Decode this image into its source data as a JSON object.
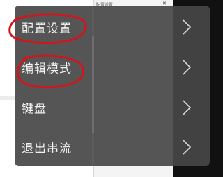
{
  "background": {
    "window_title": "配置设置"
  },
  "menu": {
    "items": [
      {
        "label": "配置设置",
        "icon": "chevron-right-icon"
      },
      {
        "label": "编辑模式",
        "icon": "chevron-right-icon"
      },
      {
        "label": "键盘",
        "icon": "chevron-right-icon"
      },
      {
        "label": "退出串流",
        "icon": "chevron-right-icon"
      }
    ]
  },
  "colors": {
    "menu_bg": "#464646",
    "text": "#f2f2f2",
    "annotation": "#d0161c"
  }
}
